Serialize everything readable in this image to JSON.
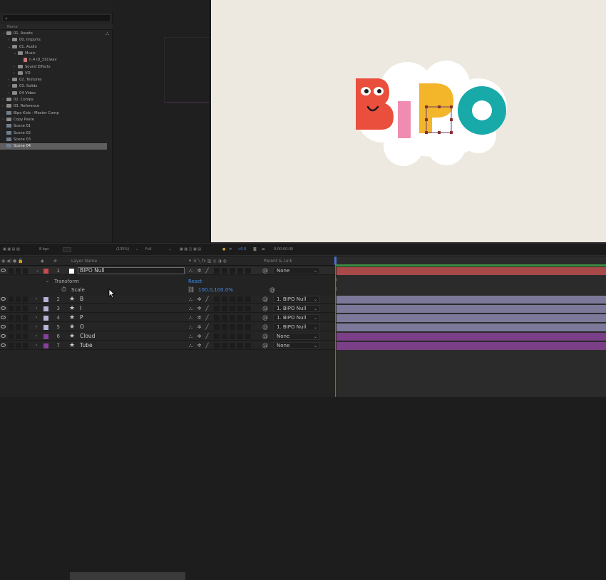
{
  "project": {
    "search_icon": "search-icon",
    "name_header": "Name",
    "tree": [
      {
        "label": "01. Assets",
        "kind": "folder",
        "indent": 0,
        "open": true
      },
      {
        "label": "00. Imports",
        "kind": "folder",
        "indent": 1,
        "open": false
      },
      {
        "label": "01. Audio",
        "kind": "folder",
        "indent": 1,
        "open": true
      },
      {
        "label": "Music",
        "kind": "folder",
        "indent": 2,
        "open": true
      },
      {
        "label": "n.4 (0_31Cwav",
        "kind": "audio",
        "indent": 3,
        "open": false
      },
      {
        "label": "Sound Effects",
        "kind": "folder",
        "indent": 2,
        "open": false
      },
      {
        "label": "VO",
        "kind": "folder",
        "indent": 2,
        "open": false
      },
      {
        "label": "02. Textures",
        "kind": "folder",
        "indent": 1,
        "open": false
      },
      {
        "label": "03. Solids",
        "kind": "folder",
        "indent": 1,
        "open": false
      },
      {
        "label": "04 Video",
        "kind": "folder",
        "indent": 1,
        "open": false
      },
      {
        "label": "02. Comps",
        "kind": "folder",
        "indent": 0,
        "open": false
      },
      {
        "label": "03. Reference",
        "kind": "folder",
        "indent": 0,
        "open": false
      },
      {
        "label": "Bipo Kids - Master Comp",
        "kind": "comp",
        "indent": 0,
        "open": false
      },
      {
        "label": "Copy Paste",
        "kind": "folder",
        "indent": 0,
        "open": false
      },
      {
        "label": "Scene 01",
        "kind": "comp",
        "indent": 0,
        "open": false
      },
      {
        "label": "Scene 02",
        "kind": "comp",
        "indent": 0,
        "open": false
      },
      {
        "label": "Scene 03",
        "kind": "comp",
        "indent": 0,
        "open": false
      },
      {
        "label": "Scene 04",
        "kind": "comp",
        "indent": 0,
        "open": false,
        "selected": true
      }
    ]
  },
  "viewer_bar": {
    "bits": "8 bpc",
    "zoom": "(135%)",
    "resolution": "Full",
    "exposure": "+0.0",
    "timecode": "0:00:00:00"
  },
  "timeline": {
    "col_index": "#",
    "col_layer_name": "Layer Name",
    "col_parent": "Parent & Link",
    "transform_label": "Transform",
    "reset_label": "Reset",
    "scale_label": "Scale",
    "scale_value": "100.0,100.0%",
    "layers": [
      {
        "index": "1",
        "name": "BIPO Null",
        "label_color": "#c94a4a",
        "parent": "None",
        "bar_color": "#a84848",
        "icon": "null-square"
      },
      {
        "index": "2",
        "name": "B",
        "label_color": "#b7b3d6",
        "parent": "1. BIPO Null",
        "bar_color": "#7b789a",
        "icon": "star-icon"
      },
      {
        "index": "3",
        "name": "I",
        "label_color": "#b7b3d6",
        "parent": "1. BIPO Null",
        "bar_color": "#7b789a",
        "icon": "star-icon"
      },
      {
        "index": "4",
        "name": "P",
        "label_color": "#b7b3d6",
        "parent": "1. BIPO Null",
        "bar_color": "#7b789a",
        "icon": "star-icon"
      },
      {
        "index": "5",
        "name": "O",
        "label_color": "#b7b3d6",
        "parent": "1. BIPO Null",
        "bar_color": "#7b789a",
        "icon": "star-icon"
      },
      {
        "index": "6",
        "name": "Cloud",
        "label_color": "#8b3f9c",
        "parent": "None",
        "bar_color": "#7a3f86",
        "icon": "star-icon"
      },
      {
        "index": "7",
        "name": "Tube",
        "label_color": "#8b3f9c",
        "parent": "None",
        "bar_color": "#7a3f86",
        "icon": "star-icon"
      }
    ]
  },
  "colors": {
    "accent_blue": "#3d8ce8",
    "work_area_green": "#3d8a3d",
    "viewer_bg": "#ede9e1"
  }
}
